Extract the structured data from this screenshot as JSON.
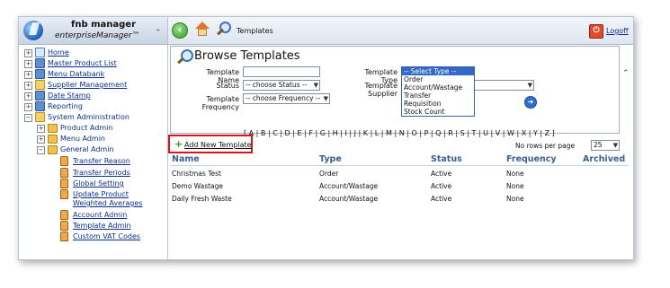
{
  "brand": {
    "title": "fnb manager",
    "subtitle": "enterpriseManager™"
  },
  "sidebar": {
    "items": [
      {
        "label": "Home"
      },
      {
        "label": "Master Product List"
      },
      {
        "label": "Menu Databank"
      },
      {
        "label": "Supplier Management"
      },
      {
        "label": "Date Stamp"
      },
      {
        "label": "Reporting"
      },
      {
        "label": "System Administration"
      },
      {
        "label": "Product Admin"
      },
      {
        "label": "Menu Admin"
      },
      {
        "label": "General Admin"
      },
      {
        "label": "Transfer Reason"
      },
      {
        "label": "Transfer Periods"
      },
      {
        "label": "Global Setting"
      },
      {
        "label": "Update Product"
      },
      {
        "label": "Weighted Averages"
      },
      {
        "label": "Account Admin"
      },
      {
        "label": "Template Admin"
      },
      {
        "label": "Custom VAT Codes"
      }
    ]
  },
  "topbar": {
    "breadcrumb": "Templates",
    "logoff": "Logoff"
  },
  "panel": {
    "title": "Browse Templates",
    "template_name_label": "Template Name",
    "status_label": "Status",
    "status_value": "-- choose Status --",
    "frequency_label": "Template Frequency",
    "frequency_value": "-- choose Frequency --",
    "type_label": "Template Type",
    "supplier_label": "Template Supplier",
    "type_options": [
      "-- Select Type --",
      "Order",
      "Account/Wastage",
      "Transfer",
      "Requisition",
      "Stock Count"
    ]
  },
  "alphabet": "[ A | B | C | D | E | F | G | H | I | J | K | L | M | N | O | P | Q | R | S | T | U | V | W | X | Y | Z ]",
  "rows_per_page_label": "No rows per page",
  "rows_per_page_value": "25",
  "add_template": "Add New Template",
  "table": {
    "headers": [
      "Name",
      "Type",
      "Status",
      "Frequency",
      "Archived"
    ],
    "rows": [
      [
        "Christmas Test",
        "Order",
        "Active",
        "None",
        ""
      ],
      [
        "Demo Wastage",
        "Account/Wastage",
        "Active",
        "None",
        ""
      ],
      [
        "Daily Fresh Waste",
        "Account/Wastage",
        "Active",
        "None",
        ""
      ]
    ]
  }
}
